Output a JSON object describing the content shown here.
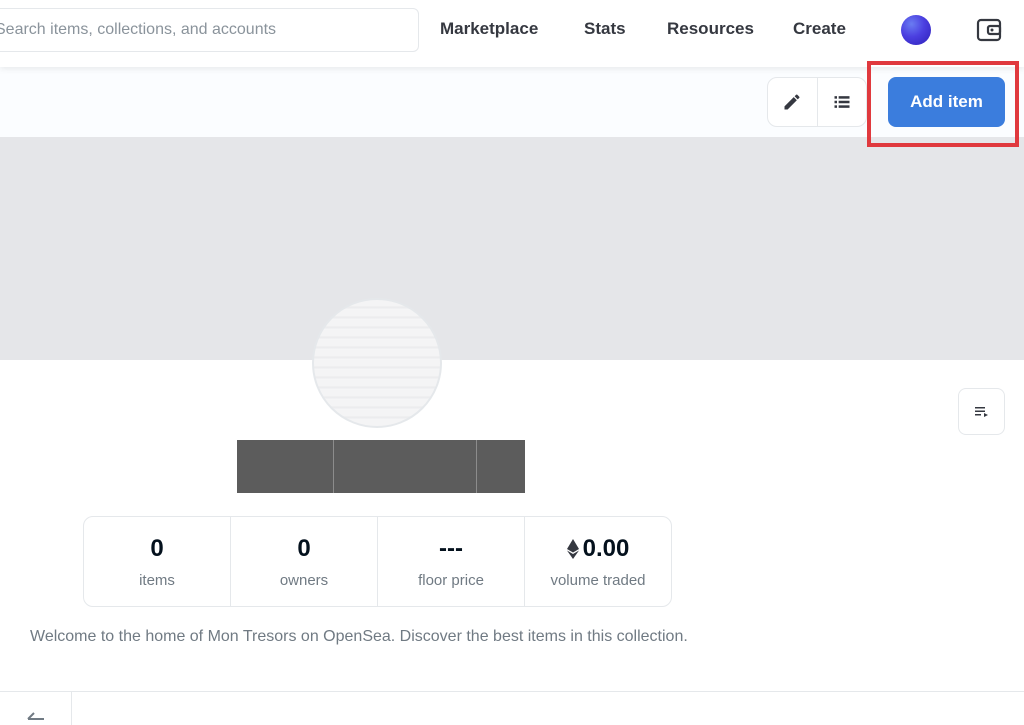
{
  "nav": {
    "search_placeholder": "Search items, collections, and accounts",
    "links": {
      "marketplace": "Marketplace",
      "stats": "Stats",
      "resources": "Resources",
      "create": "Create"
    },
    "icons": {
      "avatar": "user-avatar",
      "wallet": "wallet-icon"
    }
  },
  "toolbar": {
    "add_item_label": "Add item",
    "icons": [
      "pencil-icon",
      "list-icon"
    ],
    "accent": "#3b7ddd"
  },
  "highlight_color": "#e0393e",
  "collection": {
    "name_redacted": true,
    "stats": [
      {
        "value": "0",
        "label": "items"
      },
      {
        "value": "0",
        "label": "owners"
      },
      {
        "value": "---",
        "label": "floor price"
      },
      {
        "value": "0.00",
        "label": "volume traded",
        "icon": "ethereum-icon"
      }
    ],
    "description": "Welcome to the home of Mon Tresors on OpenSea. Discover the best items in this collection."
  }
}
